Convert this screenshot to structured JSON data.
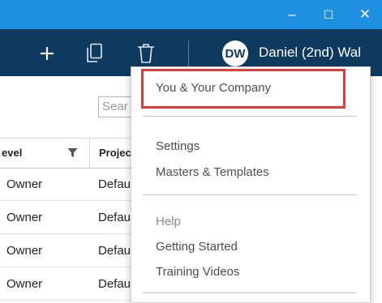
{
  "window": {
    "minimize_glyph": "–",
    "maximize_glyph": "☐",
    "close_glyph": "✕",
    "accent": "#1e8fe1"
  },
  "toolbar": {
    "background": "#0f3a5f",
    "icons": [
      "plus-icon",
      "copy-icon",
      "trash-icon"
    ],
    "user": {
      "initials": "DW",
      "name": "Daniel (2nd) Wal"
    }
  },
  "search": {
    "placeholder": "Sear"
  },
  "table": {
    "columns": [
      "evel",
      "Projec"
    ],
    "rows": [
      {
        "level": "Owner",
        "project": "Defau"
      },
      {
        "level": "Owner",
        "project": "Defau"
      },
      {
        "level": "Owner",
        "project": "Defau"
      },
      {
        "level": "Owner",
        "project": "Defau"
      }
    ]
  },
  "menu": {
    "items": [
      {
        "label": "You & Your Company"
      },
      {
        "label": "Settings"
      },
      {
        "label": "Masters & Templates"
      },
      {
        "label": "Help"
      },
      {
        "label": "Getting Started"
      },
      {
        "label": "Training Videos"
      }
    ]
  }
}
